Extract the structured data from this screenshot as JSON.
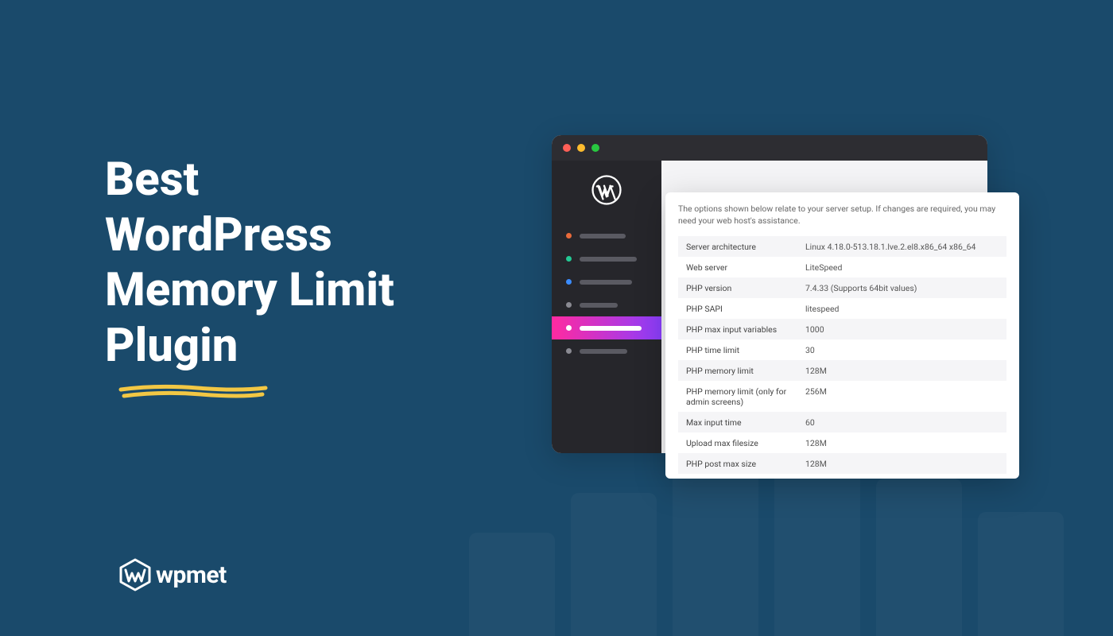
{
  "hero": {
    "title_l1": "Best",
    "title_l2": "WordPress",
    "title_l3": "Memory Limit",
    "title_l4": "Plugin"
  },
  "brand": {
    "name": "wpmet"
  },
  "browser": {
    "sidebar": {
      "items": [
        {
          "dot_color": "#e96a3a",
          "line_width": 58
        },
        {
          "dot_color": "#23c994",
          "line_width": 72
        },
        {
          "dot_color": "#3b8cff",
          "line_width": 66
        },
        {
          "dot_color": "#8a8a92",
          "line_width": 48
        },
        {
          "dot_color": "#ffffff",
          "line_width": 78,
          "active": true
        },
        {
          "dot_color": "#8a8a92",
          "line_width": 60
        }
      ]
    }
  },
  "info_card": {
    "description": "The options shown below relate to your server setup. If changes are required, you may need your web host's assistance.",
    "rows": [
      {
        "key": "Server architecture",
        "value": "Linux 4.18.0-513.18.1.lve.2.el8.x86_64 x86_64"
      },
      {
        "key": "Web server",
        "value": "LiteSpeed"
      },
      {
        "key": "PHP version",
        "value": "7.4.33 (Supports 64bit values)"
      },
      {
        "key": "PHP SAPI",
        "value": "litespeed"
      },
      {
        "key": "PHP max input variables",
        "value": "1000"
      },
      {
        "key": "PHP time limit",
        "value": "30"
      },
      {
        "key": "PHP memory limit",
        "value": "128M"
      },
      {
        "key": "PHP memory limit (only for admin screens)",
        "value": "256M"
      },
      {
        "key": "Max input time",
        "value": "60"
      },
      {
        "key": "Upload max filesize",
        "value": "128M"
      },
      {
        "key": "PHP post max size",
        "value": "128M"
      }
    ]
  },
  "ghost_bars": [
    130,
    180,
    210,
    240,
    198,
    156
  ]
}
